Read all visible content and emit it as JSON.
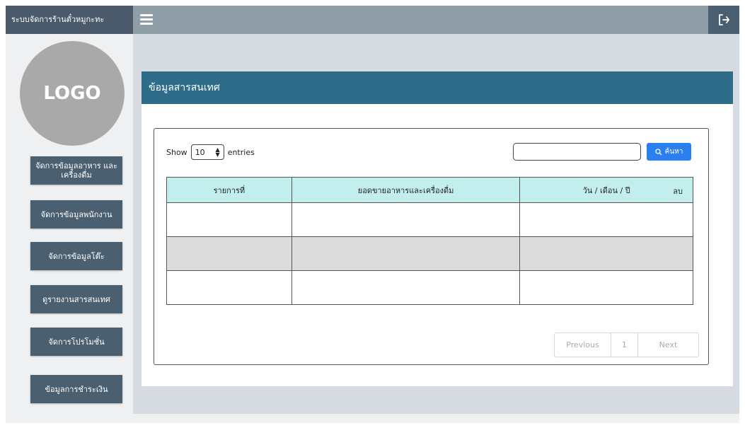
{
  "app": {
    "title": "ระบบจัดการร้านตั๋วหมูกะทะ"
  },
  "sidebar": {
    "logo_text": "LOGO",
    "items": [
      {
        "label": "จัดการข้อมูลอาหาร และเครื่องดื่ม"
      },
      {
        "label": "จัดการข้อมูลพนักงาน"
      },
      {
        "label": "จัดการข้อมูลโต๊ะ"
      },
      {
        "label": "ดูรายงานสารสนเทศ"
      },
      {
        "label": "จัดการโปรโมชั่น"
      },
      {
        "label": "ข้อมูลการชำระเงิน"
      }
    ]
  },
  "page": {
    "title": "ข้อมูลสารสนเทศ"
  },
  "table_controls": {
    "show_label": "Show",
    "entries_value": "10",
    "entries_label": "entries",
    "search_placeholder": "",
    "search_button": "ค้นหา"
  },
  "table": {
    "headers": [
      "รายการที่",
      "ยอดขายอาหารและเครื่องดื่ม",
      "วัน / เดือน / ปี"
    ],
    "unit_label": "ลบ",
    "rows": [
      [
        "",
        "",
        ""
      ],
      [
        "",
        "",
        ""
      ],
      [
        "",
        "",
        ""
      ]
    ]
  },
  "pagination": {
    "previous": "Previous",
    "page": "1",
    "next": "Next"
  },
  "colors": {
    "brand": "#4a5a6a",
    "header": "#2e6d8a",
    "accent": "#2a80f0",
    "table_head": "#c2efee"
  }
}
